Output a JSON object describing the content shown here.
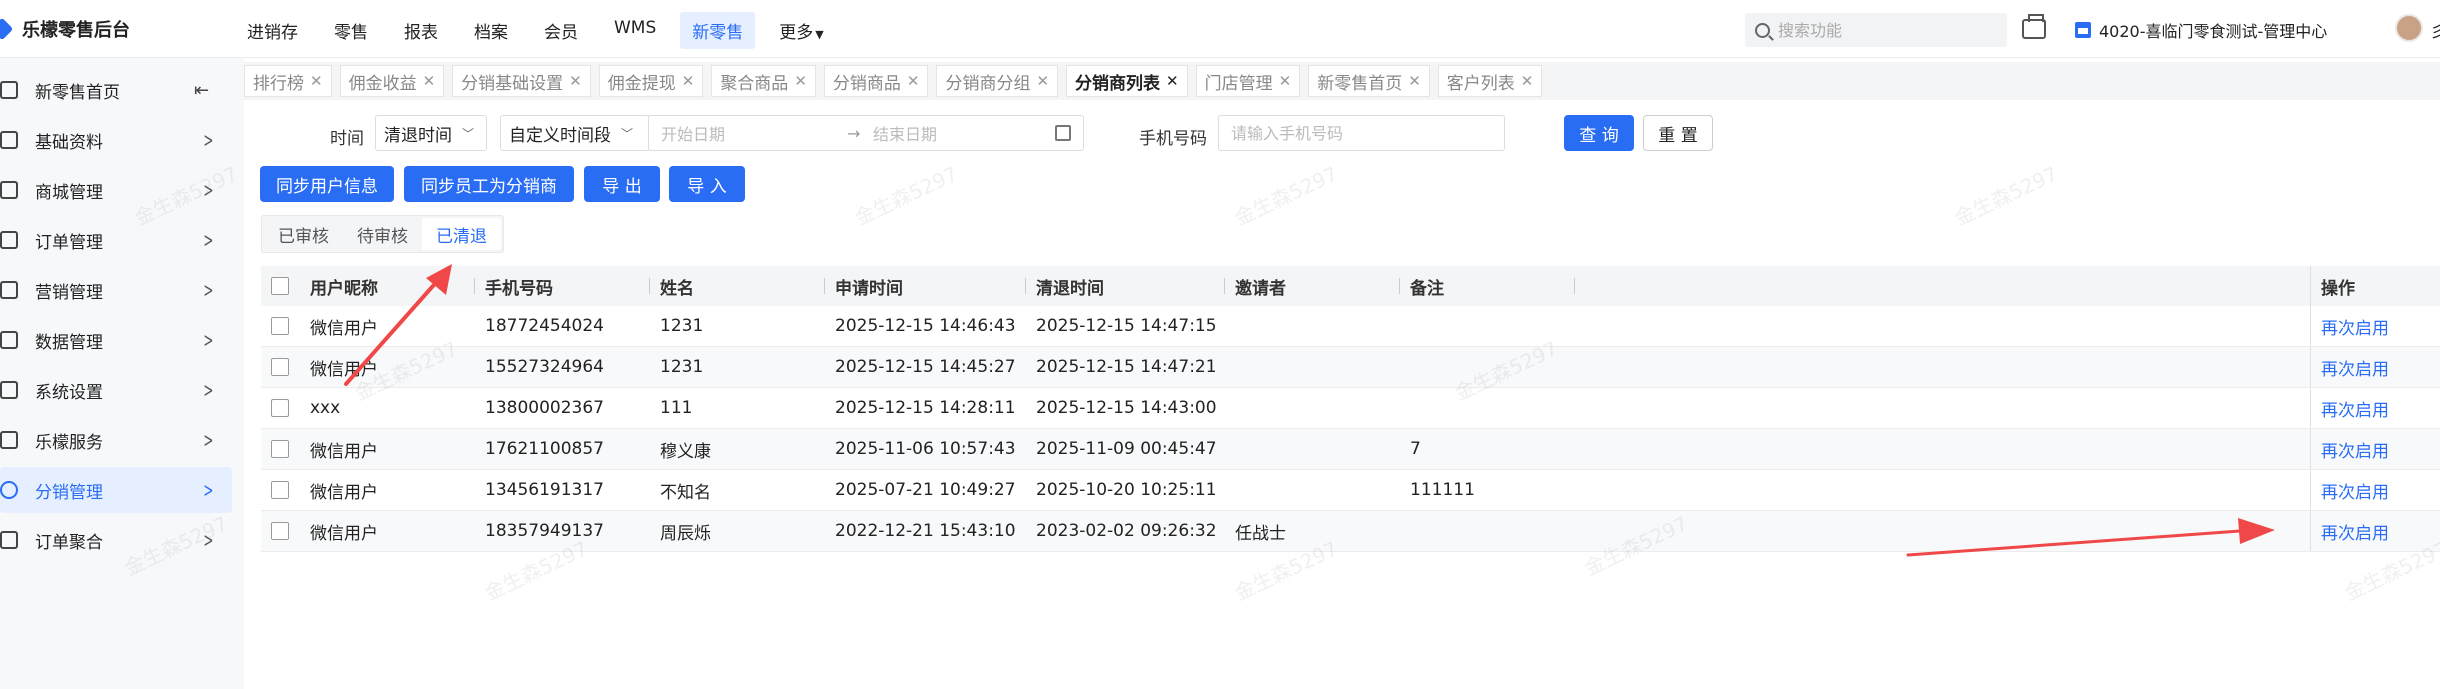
{
  "app": {
    "title": "乐檬零售后台"
  },
  "topnav": {
    "items": [
      "进销存",
      "零售",
      "报表",
      "档案",
      "会员",
      "WMS",
      "新零售",
      "更多"
    ],
    "active_index": 6,
    "search_placeholder": "搜索功能",
    "store_name": "4020-喜临门零食测试-管理中心",
    "avatar_cut": "彡"
  },
  "sidebar": {
    "items": [
      {
        "label": "新零售首页",
        "icon": "home-icon"
      },
      {
        "label": "基础资料",
        "icon": "grid-icon"
      },
      {
        "label": "商城管理",
        "icon": "shop-icon"
      },
      {
        "label": "订单管理",
        "icon": "order-icon"
      },
      {
        "label": "营销管理",
        "icon": "marketing-icon"
      },
      {
        "label": "数据管理",
        "icon": "chart-icon"
      },
      {
        "label": "系统设置",
        "icon": "settings-icon"
      },
      {
        "label": "乐檬服务",
        "icon": "service-icon"
      },
      {
        "label": "分销管理",
        "icon": "distribution-icon"
      },
      {
        "label": "订单聚合",
        "icon": "aggregate-icon"
      }
    ],
    "active_index": 8
  },
  "tabs": {
    "items": [
      "排行榜",
      "佣金收益",
      "分销基础设置",
      "佣金提现",
      "聚合商品",
      "分销商品",
      "分销商分组",
      "分销商列表",
      "门店管理",
      "新零售首页",
      "客户列表"
    ],
    "active_index": 7
  },
  "filters": {
    "time_label": "时间",
    "time_type": "清退时间",
    "range_type": "自定义时间段",
    "start_placeholder": "开始日期",
    "end_placeholder": "结束日期",
    "phone_label": "手机号码",
    "phone_placeholder": "请输入手机号码",
    "query_label": "查 询",
    "reset_label": "重 置"
  },
  "actions": {
    "sync_user": "同步用户信息",
    "sync_staff": "同步员工为分销商",
    "export": "导 出",
    "import": "导 入"
  },
  "status_tabs": {
    "items": [
      "已审核",
      "待审核",
      "已清退"
    ],
    "active_index": 2
  },
  "table": {
    "columns": [
      "用户昵称",
      "手机号码",
      "姓名",
      "申请时间",
      "清退时间",
      "邀请者",
      "备注",
      "操作"
    ],
    "rows": [
      {
        "nickname": "微信用户",
        "phone": "18772454024",
        "name": "1231",
        "apply_time": "2025-12-15 14:46:43",
        "clear_time": "2025-12-15 14:47:15",
        "inviter": "",
        "remark": "",
        "action": "再次启用"
      },
      {
        "nickname": "微信用户",
        "phone": "15527324964",
        "name": "1231",
        "apply_time": "2025-12-15 14:45:27",
        "clear_time": "2025-12-15 14:47:21",
        "inviter": "",
        "remark": "",
        "action": "再次启用"
      },
      {
        "nickname": "xxx",
        "phone": "13800002367",
        "name": "111",
        "apply_time": "2025-12-15 14:28:11",
        "clear_time": "2025-12-15 14:43:00",
        "inviter": "",
        "remark": "",
        "action": "再次启用"
      },
      {
        "nickname": "微信用户",
        "phone": "17621100857",
        "name": "穆义康",
        "apply_time": "2025-11-06 10:57:43",
        "clear_time": "2025-11-09 00:45:47",
        "inviter": "",
        "remark": "7",
        "action": "再次启用"
      },
      {
        "nickname": "微信用户",
        "phone": "13456191317",
        "name": "不知名",
        "apply_time": "2025-07-21 10:49:27",
        "clear_time": "2025-10-20 10:25:11",
        "inviter": "",
        "remark": "111111",
        "action": "再次启用"
      },
      {
        "nickname": "微信用户",
        "phone": "18357949137",
        "name": "周辰烁",
        "apply_time": "2022-12-21 15:43:10",
        "clear_time": "2023-02-02 09:26:32",
        "inviter": "任战士",
        "remark": "",
        "action": "再次启用"
      }
    ]
  },
  "watermark": "金生森5297",
  "colors": {
    "accent": "#2a6df5",
    "annotation": "#f04848"
  }
}
